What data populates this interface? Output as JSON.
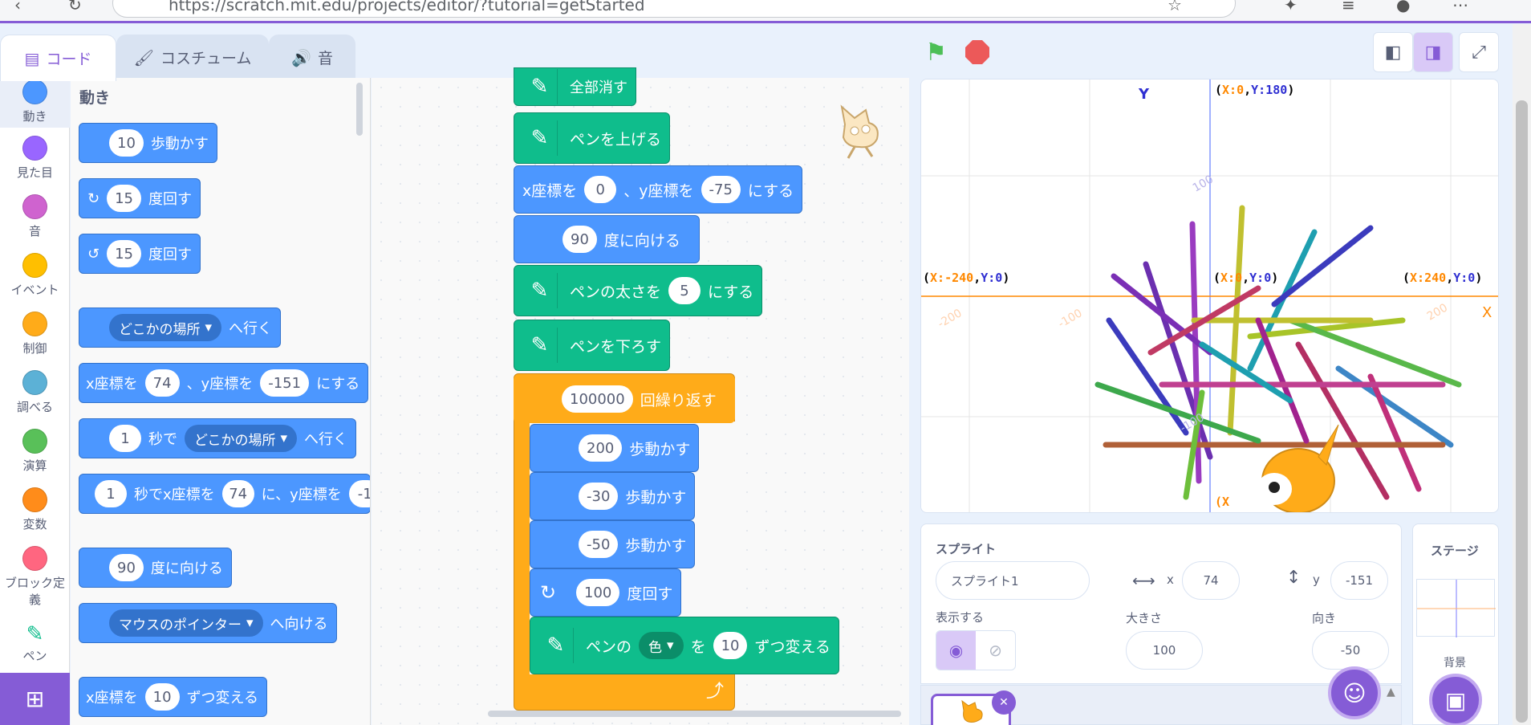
{
  "browser": {
    "url": "https://scratch.mit.edu/projects/editor/?tutorial=getStarted"
  },
  "tabs": {
    "code": "コード",
    "costume": "コスチューム",
    "sound": "音"
  },
  "categories": [
    {
      "label": "動き",
      "color": "#4c97ff"
    },
    {
      "label": "見た目",
      "color": "#9966ff"
    },
    {
      "label": "音",
      "color": "#cf63cf"
    },
    {
      "label": "イベント",
      "color": "#ffbf00"
    },
    {
      "label": "制御",
      "color": "#ffab19"
    },
    {
      "label": "調べる",
      "color": "#5cb1d6"
    },
    {
      "label": "演算",
      "color": "#59c059"
    },
    {
      "label": "変数",
      "color": "#ff8c1a"
    },
    {
      "label": "ブロック定義",
      "color": "#ff6680"
    },
    {
      "label": "ペン",
      "color": "#0fbd8c"
    }
  ],
  "palette": {
    "title": "動き",
    "move": {
      "value": "10",
      "text": "歩動かす"
    },
    "turn_right": {
      "value": "15",
      "text": "度回す"
    },
    "turn_left": {
      "value": "15",
      "text": "度回す"
    },
    "goto": {
      "option": "どこかの場所",
      "text": "へ行く"
    },
    "gotoxy": {
      "pre": "x座標を",
      "x": "74",
      "mid": "、y座標を",
      "y": "-151",
      "post": "にする"
    },
    "glide": {
      "value": "1",
      "mid": "秒で",
      "option": "どこかの場所",
      "post": "へ行く"
    },
    "glidexy": {
      "value": "1",
      "mid": "秒でx座標を",
      "x": "74",
      "mid2": "に、y座標を",
      "y": "-1"
    },
    "point": {
      "value": "90",
      "text": "度に向ける"
    },
    "pointto": {
      "option": "マウスのポインター",
      "text": "へ向ける"
    },
    "changex": {
      "pre": "x座標を",
      "value": "10",
      "post": "ずつ変える"
    }
  },
  "script": {
    "clear": "全部消す",
    "penup": "ペンを上げる",
    "gotoxy": {
      "pre": "x座標を",
      "x": "0",
      "mid": "、y座標を",
      "y": "-75",
      "post": "にする"
    },
    "point": {
      "value": "90",
      "text": "度に向ける"
    },
    "pensize": {
      "pre": "ペンの太さを",
      "value": "5",
      "post": "にする"
    },
    "pendown": "ペンを下ろす",
    "repeat": {
      "value": "100000",
      "text": "回繰り返す"
    },
    "move1": {
      "value": "200",
      "text": "歩動かす"
    },
    "move2": {
      "value": "-30",
      "text": "歩動かす"
    },
    "move3": {
      "value": "-50",
      "text": "歩動かす"
    },
    "turn": {
      "value": "100",
      "text": "度回す"
    },
    "changepen": {
      "pre": "ペンの",
      "option": "色",
      "mid": "を",
      "value": "10",
      "post": "ずつ変える"
    }
  },
  "stage": {
    "y_axis": "Y",
    "x_axis": "X",
    "top": {
      "x": "X:0",
      "y": "Y:180"
    },
    "left": {
      "x": "X:-240",
      "y": "Y:0"
    },
    "right": {
      "x": "X:240",
      "y": "Y:0"
    },
    "center": {
      "x": "X:0",
      "y": "Y:0"
    },
    "tick_100": "100",
    "tick_m200": "-200",
    "tick_m100": "-100",
    "tick_200": "200",
    "tick_m100y": "-100",
    "bottom_partial": "X"
  },
  "sprite": {
    "label": "スプライト",
    "name": "スプライト1",
    "x_label": "x",
    "x": "74",
    "y_label": "y",
    "y": "-151",
    "show_label": "表示する",
    "size_label": "大きさ",
    "size": "100",
    "direction_label": "向き",
    "direction": "-50"
  },
  "stage_pane": {
    "label": "ステージ",
    "backdrop_label": "背景"
  },
  "colors": {
    "motion": "#4c97ff",
    "pen": "#0fbd8c",
    "control": "#ffab19",
    "accent": "#855cd6"
  }
}
